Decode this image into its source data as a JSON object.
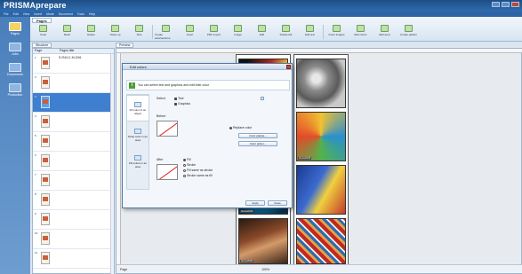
{
  "app": {
    "title": "PRISMAprepare"
  },
  "menubar": [
    "File",
    "Edit",
    "View",
    "Insert",
    "Mode",
    "Document",
    "Tools",
    "Help"
  ],
  "left_nav": [
    {
      "label": "Pages"
    },
    {
      "label": "Jobs"
    },
    {
      "label": "Documents"
    },
    {
      "label": "Production"
    }
  ],
  "ribbon": {
    "tab": "Pages",
    "tools": [
      "Undo",
      "Redo",
      "Delete",
      "Clean up",
      "Size",
      "Create sets/sections",
      "Insert",
      "PDF import",
      "Image",
      "Edit",
      "Rotate left",
      "Edit text",
      "Insert images",
      "Edit colors",
      "Edit area",
      "Create pattern"
    ]
  },
  "panels": {
    "structure_tab": "Structure",
    "preview_tab": "Preview"
  },
  "structure": {
    "col_page": "Page",
    "col_title": "Pages title",
    "rows": [
      {
        "num": "1",
        "title": "S-R4/LC-M-G06"
      },
      {
        "num": "2",
        "title": ""
      },
      {
        "num": "3",
        "title": ""
      },
      {
        "num": "4",
        "title": ""
      },
      {
        "num": "5",
        "title": ""
      },
      {
        "num": "6",
        "title": ""
      },
      {
        "num": "7",
        "title": ""
      },
      {
        "num": "8",
        "title": ""
      },
      {
        "num": "9",
        "title": ""
      },
      {
        "num": "10",
        "title": ""
      },
      {
        "num": "11",
        "title": ""
      }
    ]
  },
  "dialog": {
    "title": "Edit colors",
    "info": "You can select text and graphics and edit their color",
    "side": [
      "Fill color of an object",
      "Draw color in an area",
      "Fill colors in an area"
    ],
    "select_label": "Select",
    "opt_text": "Text",
    "opt_graphics": "Graphics",
    "before_label": "Before",
    "after_label": "After",
    "replace_label": "Replace color",
    "color_palette_btn": "Color palette...",
    "color_picker_btn": "Color picker...",
    "after_opts": [
      "Fill",
      "Stroke",
      "Fill same as stroke",
      "Stroke same as fill"
    ],
    "apply_btn": "Apply",
    "close_btn": "Close"
  },
  "preview": {
    "labels": [
      "DeviceRGB",
      "DeviceRGB",
      "DeviceRGB",
      "DeviceRGB"
    ],
    "bottom_page": "Page",
    "zoom": "100%"
  }
}
